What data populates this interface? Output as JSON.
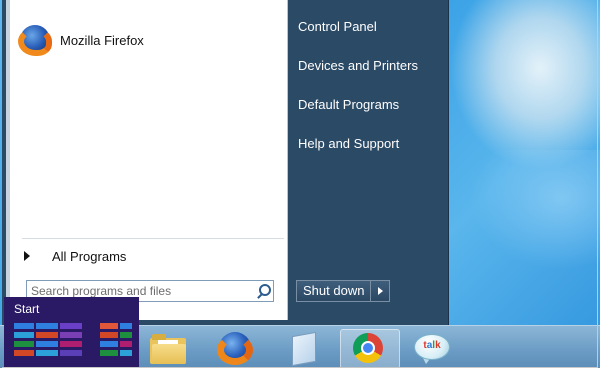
{
  "start_menu": {
    "pinned": [
      {
        "label": "Mozilla Firefox",
        "icon": "firefox-icon"
      }
    ],
    "all_programs_label": "All Programs",
    "search": {
      "placeholder": "Search programs and files",
      "value": ""
    },
    "right_items": [
      {
        "label": "Control Panel"
      },
      {
        "label": "Devices and Printers"
      },
      {
        "label": "Default Programs"
      },
      {
        "label": "Help and Support"
      }
    ],
    "shutdown_label": "Shut down"
  },
  "start_button": {
    "label": "Start"
  },
  "taskbar": {
    "items": [
      {
        "name": "file-explorer",
        "icon": "folder-icon"
      },
      {
        "name": "firefox",
        "icon": "firefox-icon"
      },
      {
        "name": "notepad",
        "icon": "notepad-icon"
      },
      {
        "name": "chrome",
        "icon": "chrome-icon",
        "active": true
      },
      {
        "name": "google-talk",
        "icon": "talk-icon",
        "text": "talk"
      }
    ]
  },
  "colors": {
    "menu_right_pane": "#2b4a66",
    "start_tile": "#2a1a66",
    "taskbar": "#6a9bc4"
  }
}
